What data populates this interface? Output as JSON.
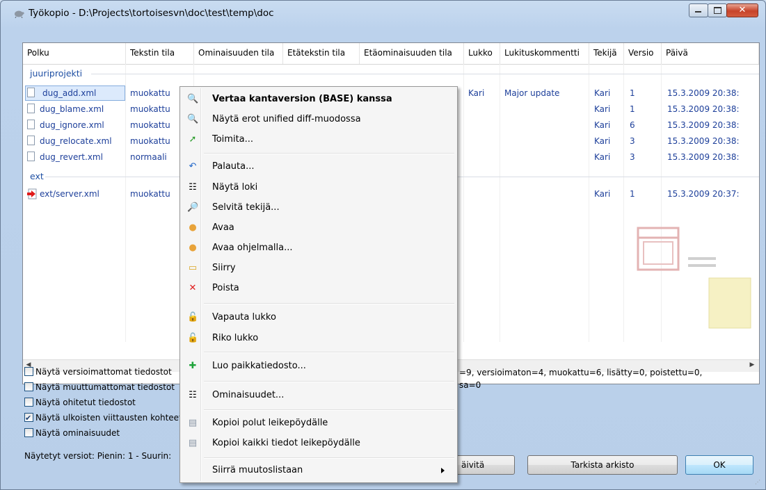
{
  "window": {
    "title": "Työkopio - D:\\Projects\\tortoisesvn\\doc\\test\\temp\\doc"
  },
  "columns": [
    "Polku",
    "Tekstin tila",
    "Ominaisuuden tila",
    "Etätekstin tila",
    "Etäominaisuuden tila",
    "Lukko",
    "Lukituskommentti",
    "Tekijä",
    "Versio",
    "Päivä"
  ],
  "groups": {
    "root": "juuriprojekti",
    "ext": "ext"
  },
  "rows": [
    {
      "path": "dug_add.xml",
      "status": "muokattu",
      "lock": "Kari",
      "lock_comment": "Major update",
      "author": "Kari",
      "rev": "1",
      "date": "15.3.2009 20:38:"
    },
    {
      "path": "dug_blame.xml",
      "status": "muokattu",
      "author": "Kari",
      "rev": "1",
      "date": "15.3.2009 20:38:"
    },
    {
      "path": "dug_ignore.xml",
      "status": "muokattu",
      "author": "Kari",
      "rev": "6",
      "date": "15.3.2009 20:38:"
    },
    {
      "path": "dug_relocate.xml",
      "status": "muokattu",
      "author": "Kari",
      "rev": "3",
      "date": "15.3.2009 20:38:"
    },
    {
      "path": "dug_revert.xml",
      "status": "normaali",
      "author": "Kari",
      "rev": "3",
      "date": "15.3.2009 20:38:"
    }
  ],
  "ext_rows": [
    {
      "path": "ext/server.xml",
      "status": "muokattu",
      "author": "Kari",
      "rev": "1",
      "date": "15.3.2009 20:37:"
    }
  ],
  "checkboxes": [
    {
      "label": "Näytä versioimattomat tiedostot",
      "checked": false
    },
    {
      "label": "Näytä muuttumattomat tiedostot",
      "checked": false
    },
    {
      "label": "Näytä ohitetut tiedostot",
      "checked": false
    },
    {
      "label": "Näytä ulkoisten viittausten kohteet",
      "checked": true
    },
    {
      "label": "Näytä ominaisuudet",
      "checked": false
    }
  ],
  "status": {
    "line1": "=9, versioimaton=4, muokattu=6, lisätty=0, poistettu=0,",
    "line2": "sa=0"
  },
  "versions_label": "Näytetyt versiot: Pienin: 1 - Suurin:",
  "buttons": {
    "refresh": "äivitä",
    "check_repo": "Tarkista arkisto",
    "ok": "OK"
  },
  "menu": {
    "items": [
      {
        "label": "Vertaa kantaversion (BASE) kanssa",
        "icon": "diff-magnifier-icon",
        "bold": true
      },
      {
        "label": "Näytä erot unified diff-muodossa",
        "icon": "unified-diff-icon"
      },
      {
        "label": "Toimita...",
        "icon": "commit-arrow-icon"
      },
      {
        "label": "Palauta...",
        "icon": "revert-icon"
      },
      {
        "label": "Näytä loki",
        "icon": "log-icon"
      },
      {
        "label": "Selvitä tekijä...",
        "icon": "blame-icon"
      },
      {
        "label": "Avaa",
        "icon": "open-icon"
      },
      {
        "label": "Avaa ohjelmalla...",
        "icon": "open-with-icon"
      },
      {
        "label": "Siirry",
        "icon": "folder-icon"
      },
      {
        "label": "Poista",
        "icon": "delete-icon"
      },
      {
        "label": "Vapauta lukko",
        "icon": "unlock-icon"
      },
      {
        "label": "Riko lukko",
        "icon": "break-lock-icon"
      },
      {
        "label": "Luo paikkatiedosto...",
        "icon": "patch-icon"
      },
      {
        "label": "Ominaisuudet...",
        "icon": "properties-icon"
      },
      {
        "label": "Kopioi polut leikepöydälle",
        "icon": "copy-paths-icon"
      },
      {
        "label": "Kopioi kaikki tiedot leikepöydälle",
        "icon": "copy-all-icon"
      },
      {
        "label": "Siirrä muutoslistaan",
        "icon": "submenu-arrow-icon"
      }
    ]
  }
}
